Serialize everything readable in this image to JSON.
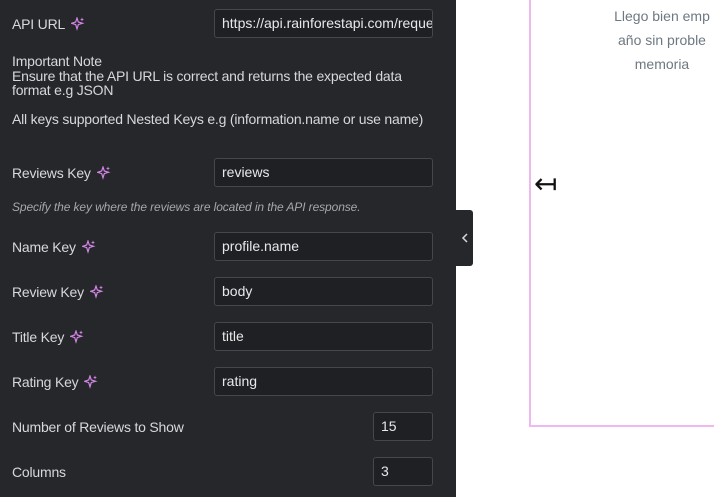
{
  "panel": {
    "api_url": {
      "label": "API URL",
      "value": "https://api.rainforestapi.com/request"
    },
    "important_note": {
      "title": "Important Note",
      "body": "Ensure that the API URL is correct and returns the expected data format e.g JSON"
    },
    "nested_note": "All keys supported Nested Keys e.g (information.name or use name)",
    "reviews_key": {
      "label": "Reviews Key",
      "value": "reviews",
      "hint": "Specify the key where the reviews are located in the API response."
    },
    "name_key": {
      "label": "Name Key",
      "value": "profile.name"
    },
    "review_key": {
      "label": "Review Key",
      "value": "body"
    },
    "title_key": {
      "label": "Title Key",
      "value": "title"
    },
    "rating_key": {
      "label": "Rating Key",
      "value": "rating"
    },
    "num_reviews": {
      "label": "Number of Reviews to Show",
      "value": "15"
    },
    "columns": {
      "label": "Columns",
      "value": "3"
    }
  },
  "collapse_icon": "chevron-left",
  "preview": {
    "review_lines": [
      "Llego bien emp",
      "año sin proble",
      "memoria"
    ],
    "arrow_glyph": "↤"
  },
  "colors": {
    "panel_bg": "#26272b",
    "input_bg": "#1f2023",
    "ai_icon": "#d486e6",
    "frame_border": "#f0b8f0"
  }
}
